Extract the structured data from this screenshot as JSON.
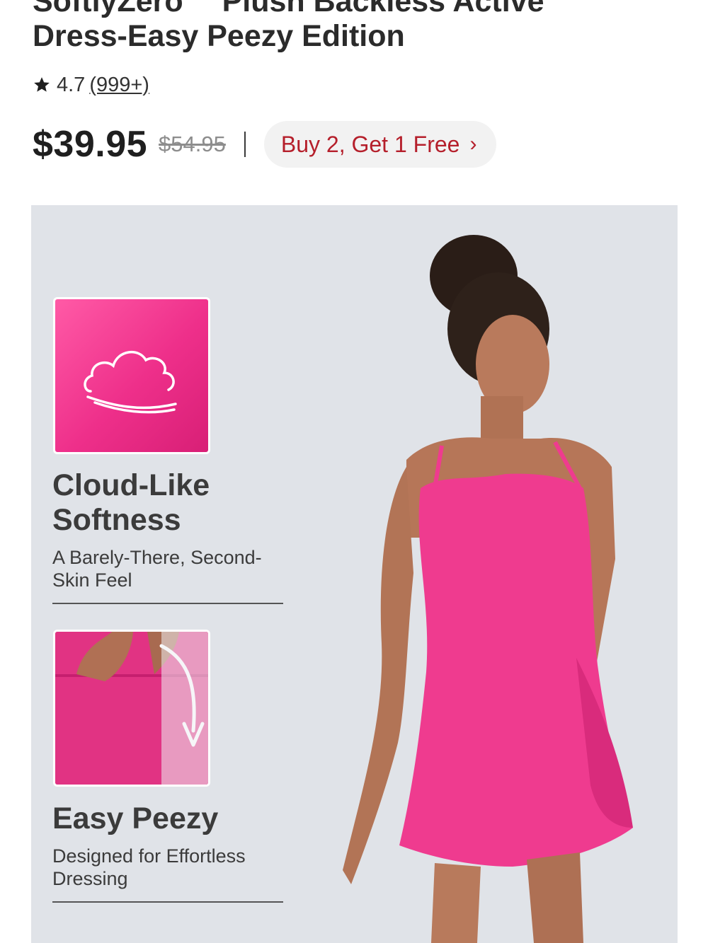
{
  "product": {
    "title_line1": "SoftlyZero™ Plush Backless Active",
    "title_line2": "Dress-Easy Peezy Edition",
    "rating": "4.7",
    "review_count": "(999+)",
    "price": "$39.95",
    "original_price": "$54.95",
    "promo_label": "Buy 2, Get 1 Free"
  },
  "features": [
    {
      "heading_line1": "Cloud-Like",
      "heading_line2": "Softness",
      "sub": "A Barely-There, Second-Skin Feel",
      "icon": "cloud-icon"
    },
    {
      "heading_line1": "Easy Peezy",
      "sub": "Designed for Effortless Dressing",
      "icon": "down-arrow-icon"
    }
  ],
  "colors": {
    "accent_pink": "#ee2f8a",
    "promo_red": "#b51f2b",
    "panel_bg": "#e0e3e8"
  }
}
